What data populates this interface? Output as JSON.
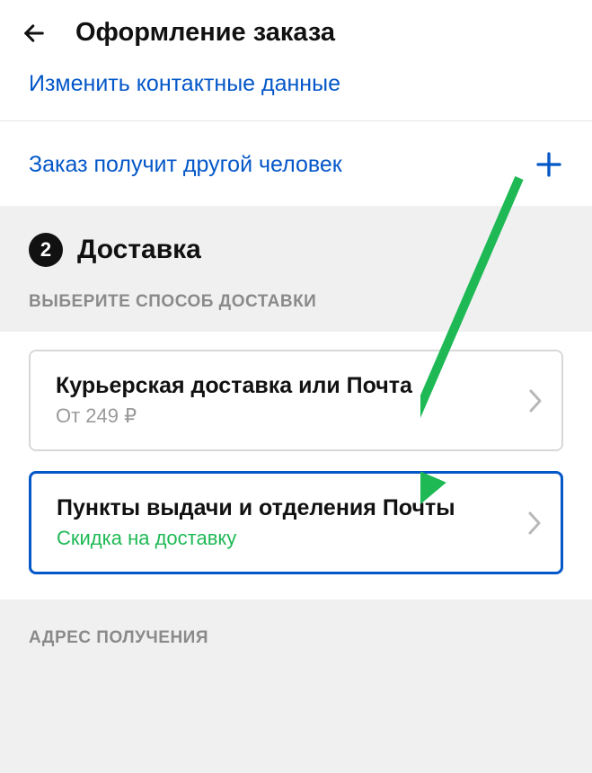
{
  "header": {
    "title": "Оформление заказа"
  },
  "contact": {
    "edit_link": "Изменить контактные данные",
    "other_person": "Заказ получит другой человек"
  },
  "step": {
    "number": "2",
    "title": "Доставка",
    "choose_label": "ВЫБЕРИТЕ СПОСОБ ДОСТАВКИ"
  },
  "delivery_options": [
    {
      "title": "Курьерская доставка или Почта",
      "subtitle": "От 249 ₽",
      "selected": false
    },
    {
      "title": "Пункты выдачи и отделения Почты",
      "subtitle": "Скидка на доставку",
      "selected": true
    }
  ],
  "address": {
    "label": "АДРЕС ПОЛУЧЕНИЯ"
  }
}
